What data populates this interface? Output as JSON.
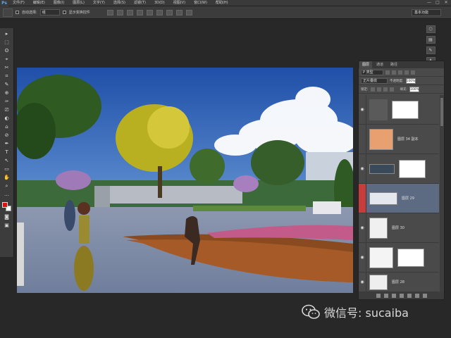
{
  "menubar": {
    "logo": "Ps",
    "items": [
      "文件(F)",
      "编辑(E)",
      "图像(I)",
      "图层(L)",
      "文字(Y)",
      "选择(S)",
      "滤镜(T)",
      "3D(D)",
      "视图(V)",
      "窗口(W)",
      "帮助(H)"
    ],
    "controls": [
      "—",
      "□",
      "✕"
    ]
  },
  "options": {
    "auto_select_label": "自动选择:",
    "auto_select_value": "组",
    "show_transform_label": "显示变换控件",
    "workspace_value": "基本功能"
  },
  "tools": [
    "▸",
    "⬚",
    "ʘ",
    "⌖",
    "✂",
    "⌗",
    "✎",
    "⊕",
    "✑",
    "⎚",
    "◐",
    "⌂",
    "⊘",
    "✒",
    "T",
    "↖",
    "▭",
    "✋",
    "⌕",
    "…"
  ],
  "dock": [
    "⬡",
    "▤",
    "✎",
    "A",
    "¶"
  ],
  "layers": {
    "tabs": [
      "图层",
      "通道",
      "路径"
    ],
    "filter_value": "P 类型",
    "blend_value": "正片叠底",
    "opacity_label": "不透明度:",
    "opacity_value": "100%",
    "lock_label": "锁定:",
    "fill_label": "填充:",
    "fill_value": "100%",
    "rows": [
      {
        "name": "",
        "visible": "◉"
      },
      {
        "name": "图层 34 副本",
        "visible": ""
      },
      {
        "name": "",
        "visible": "◉"
      },
      {
        "name": "图层 29",
        "visible": ""
      },
      {
        "name": "图层 30",
        "visible": "◉"
      },
      {
        "name": "",
        "visible": "◉"
      },
      {
        "name": "图层 28",
        "visible": "◉"
      }
    ]
  },
  "watermark": {
    "text": "微信号: sucaiba"
  }
}
